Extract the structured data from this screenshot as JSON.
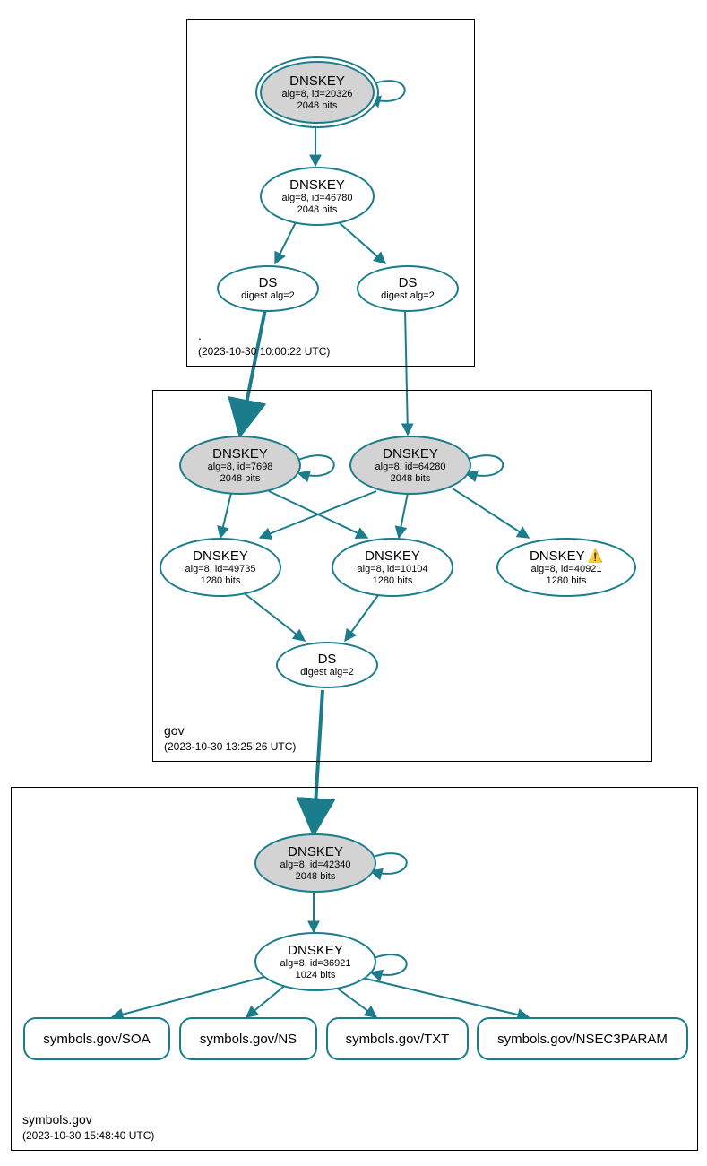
{
  "colors": {
    "stroke": "#1b7d8c",
    "ksk_fill": "#d3d3d3"
  },
  "zones": {
    "root": {
      "name": ".",
      "timestamp": "(2023-10-30 10:00:22 UTC)"
    },
    "gov": {
      "name": "gov",
      "timestamp": "(2023-10-30 13:25:26 UTC)"
    },
    "symbols": {
      "name": "symbols.gov",
      "timestamp": "(2023-10-30 15:48:40 UTC)"
    }
  },
  "nodes": {
    "root_ksk": {
      "title": "DNSKEY",
      "line1": "alg=8, id=20326",
      "line2": "2048 bits"
    },
    "root_zsk": {
      "title": "DNSKEY",
      "line1": "alg=8, id=46780",
      "line2": "2048 bits"
    },
    "root_ds1": {
      "title": "DS",
      "line1": "digest alg=2"
    },
    "root_ds2": {
      "title": "DS",
      "line1": "digest alg=2"
    },
    "gov_ksk1": {
      "title": "DNSKEY",
      "line1": "alg=8, id=7698",
      "line2": "2048 bits"
    },
    "gov_ksk2": {
      "title": "DNSKEY",
      "line1": "alg=8, id=64280",
      "line2": "2048 bits"
    },
    "gov_zsk1": {
      "title": "DNSKEY",
      "line1": "alg=8, id=49735",
      "line2": "1280 bits"
    },
    "gov_zsk2": {
      "title": "DNSKEY",
      "line1": "alg=8, id=10104",
      "line2": "1280 bits"
    },
    "gov_zsk3": {
      "title": "DNSKEY",
      "line1": "alg=8, id=40921",
      "line2": "1280 bits",
      "warn": true
    },
    "gov_ds": {
      "title": "DS",
      "line1": "digest alg=2"
    },
    "sym_ksk": {
      "title": "DNSKEY",
      "line1": "alg=8, id=42340",
      "line2": "2048 bits"
    },
    "sym_zsk": {
      "title": "DNSKEY",
      "line1": "alg=8, id=36921",
      "line2": "1024 bits"
    },
    "sym_soa": {
      "title": "symbols.gov/SOA"
    },
    "sym_ns": {
      "title": "symbols.gov/NS"
    },
    "sym_txt": {
      "title": "symbols.gov/TXT"
    },
    "sym_nsec3": {
      "title": "symbols.gov/NSEC3PARAM"
    }
  }
}
